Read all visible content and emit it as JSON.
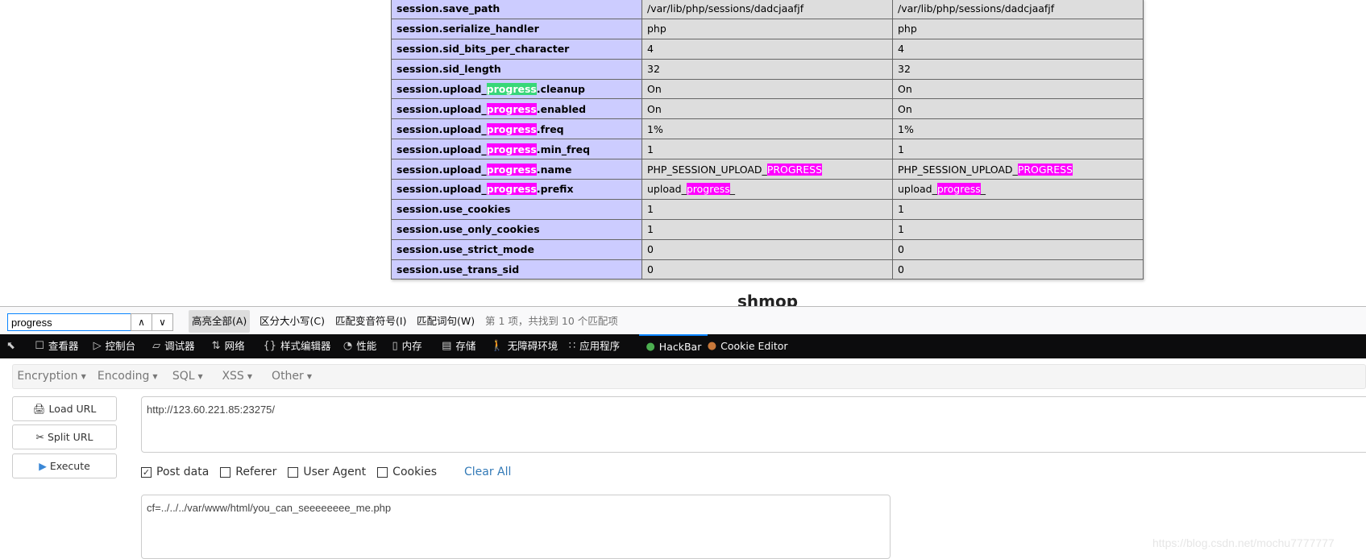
{
  "table": {
    "rows": [
      {
        "key": [
          "session.save_path",
          "",
          ""
        ],
        "local": [
          "/var/lib/php/sessions/dadcjaafjf",
          "",
          ""
        ],
        "master": [
          "/var/lib/php/sessions/dadcjaafjf",
          "",
          ""
        ]
      },
      {
        "key": [
          "session.serialize_handler",
          "",
          ""
        ],
        "local": [
          "php",
          "",
          ""
        ],
        "master": [
          "php",
          "",
          ""
        ]
      },
      {
        "key": [
          "session.sid_bits_per_character",
          "",
          ""
        ],
        "local": [
          "4",
          "",
          ""
        ],
        "master": [
          "4",
          "",
          ""
        ]
      },
      {
        "key": [
          "session.sid_length",
          "",
          ""
        ],
        "local": [
          "32",
          "",
          ""
        ],
        "master": [
          "32",
          "",
          ""
        ]
      },
      {
        "key": [
          "session.upload_",
          "progress",
          ".cleanup"
        ],
        "current": true,
        "local": [
          "On",
          "",
          ""
        ],
        "master": [
          "On",
          "",
          ""
        ]
      },
      {
        "key": [
          "session.upload_",
          "progress",
          ".enabled"
        ],
        "local": [
          "On",
          "",
          ""
        ],
        "master": [
          "On",
          "",
          ""
        ]
      },
      {
        "key": [
          "session.upload_",
          "progress",
          ".freq"
        ],
        "local": [
          "1%",
          "",
          ""
        ],
        "master": [
          "1%",
          "",
          ""
        ]
      },
      {
        "key": [
          "session.upload_",
          "progress",
          ".min_freq"
        ],
        "local": [
          "1",
          "",
          ""
        ],
        "master": [
          "1",
          "",
          ""
        ]
      },
      {
        "key": [
          "session.upload_",
          "progress",
          ".name"
        ],
        "local": [
          "PHP_SESSION_UPLOAD_",
          "PROGRESS",
          ""
        ],
        "master": [
          "PHP_SESSION_UPLOAD_",
          "PROGRESS",
          ""
        ]
      },
      {
        "key": [
          "session.upload_",
          "progress",
          ".prefix"
        ],
        "local": [
          "upload_",
          "progress",
          "_"
        ],
        "master": [
          "upload_",
          "progress",
          "_"
        ]
      },
      {
        "key": [
          "session.use_cookies",
          "",
          ""
        ],
        "local": [
          "1",
          "",
          ""
        ],
        "master": [
          "1",
          "",
          ""
        ]
      },
      {
        "key": [
          "session.use_only_cookies",
          "",
          ""
        ],
        "local": [
          "1",
          "",
          ""
        ],
        "master": [
          "1",
          "",
          ""
        ]
      },
      {
        "key": [
          "session.use_strict_mode",
          "",
          ""
        ],
        "local": [
          "0",
          "",
          ""
        ],
        "master": [
          "0",
          "",
          ""
        ]
      },
      {
        "key": [
          "session.use_trans_sid",
          "",
          ""
        ],
        "local": [
          "0",
          "",
          ""
        ],
        "master": [
          "0",
          "",
          ""
        ]
      }
    ]
  },
  "next_section": "shmop",
  "colors": {
    "highlight": "#ff00ff",
    "current_highlight": "#38d878",
    "key_bg": "#ccccff",
    "value_bg": "#dddddd",
    "accent": "#0a84ff"
  },
  "findbar": {
    "query": "progress",
    "highlight_all": "高亮全部(A)",
    "match_case": "区分大小写(C)",
    "match_diacritics": "匹配变音符号(I)",
    "whole_words": "匹配词句(W)",
    "status": "第 1 项，共找到 10 个匹配项"
  },
  "devtools": {
    "tabs": [
      {
        "label": "查看器",
        "icon": "inspector-icon"
      },
      {
        "label": "控制台",
        "icon": "console-icon"
      },
      {
        "label": "调试器",
        "icon": "debugger-icon"
      },
      {
        "label": "网络",
        "icon": "network-icon"
      },
      {
        "label": "样式编辑器",
        "icon": "style-editor-icon"
      },
      {
        "label": "性能",
        "icon": "performance-icon"
      },
      {
        "label": "内存",
        "icon": "memory-icon"
      },
      {
        "label": "存储",
        "icon": "storage-icon"
      },
      {
        "label": "无障碍环境",
        "icon": "accessibility-icon"
      },
      {
        "label": "应用程序",
        "icon": "application-icon"
      },
      {
        "label": "HackBar",
        "icon": "hackbar-icon",
        "selected": true
      },
      {
        "label": "Cookie Editor",
        "icon": "cookie-icon"
      }
    ]
  },
  "hackbar": {
    "menu": [
      "Encryption",
      "Encoding",
      "SQL",
      "XSS",
      "Other"
    ],
    "buttons": {
      "load": "Load URL",
      "split": "Split URL",
      "execute": "Execute"
    },
    "url": "http://123.60.221.85:23275/",
    "options": [
      {
        "label": "Post data",
        "checked": true
      },
      {
        "label": "Referer",
        "checked": false
      },
      {
        "label": "User Agent",
        "checked": false
      },
      {
        "label": "Cookies",
        "checked": false
      }
    ],
    "clear_all": "Clear All",
    "post_data": "cf=../../../var/www/html/you_can_seeeeeeee_me.php"
  },
  "watermark": "https://blog.csdn.net/mochu7777777"
}
